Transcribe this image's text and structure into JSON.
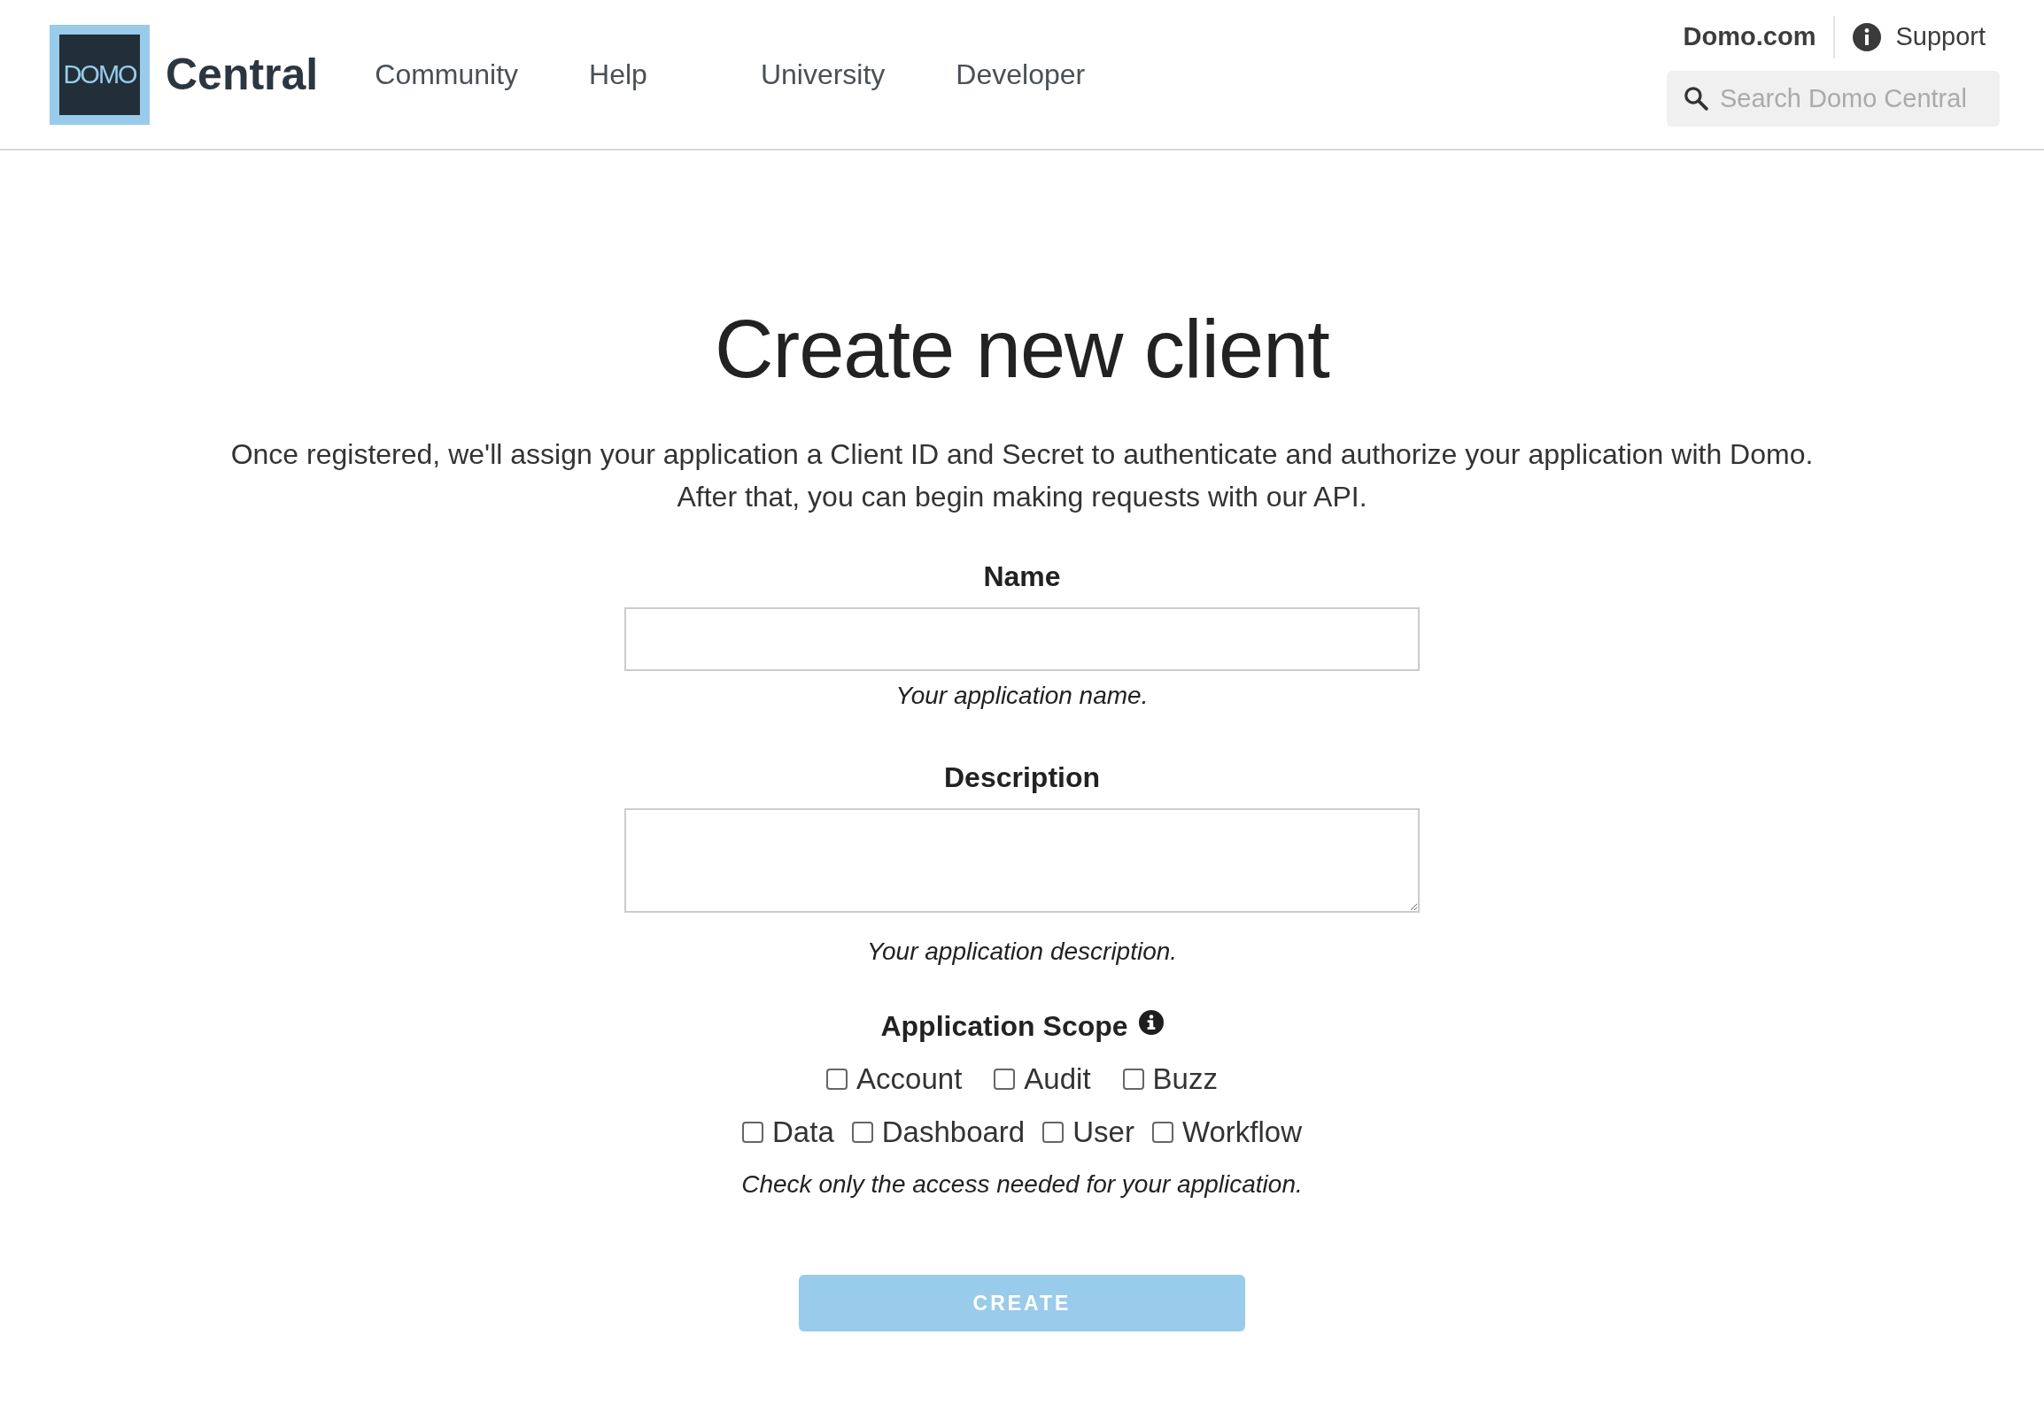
{
  "header": {
    "logo_text": "DOMO",
    "brand": "Central",
    "nav": [
      {
        "label": "Community"
      },
      {
        "label": "Help"
      },
      {
        "label": "University"
      },
      {
        "label": "Developer"
      }
    ],
    "site_link": "Domo.com",
    "support_link": "Support",
    "search": {
      "placeholder": "Search Domo Central"
    }
  },
  "form": {
    "title": "Create new client",
    "intro": [
      "Once registered, we'll assign your application a Client ID and Secret to authenticate and authorize your application with Domo.",
      "After that, you can begin making requests with our API."
    ],
    "fields": [
      {
        "kind": "input",
        "label": "Name",
        "hint": "Your application name."
      },
      {
        "kind": "textarea",
        "label": "Description",
        "hint": "Your application description."
      }
    ],
    "scope": {
      "label": "Application Scope",
      "lines": [
        {
          "options": [
            {
              "label": "Account",
              "checked": false
            },
            {
              "label": "Audit",
              "checked": false
            },
            {
              "label": "Buzz",
              "checked": false
            }
          ]
        },
        {
          "options": [
            {
              "label": "Data",
              "checked": false
            },
            {
              "label": "Dashboard",
              "checked": false
            },
            {
              "label": "User",
              "checked": false
            },
            {
              "label": "Workflow",
              "checked": false
            }
          ]
        }
      ],
      "hint": "Check only the access needed for your application."
    },
    "submit": {
      "label": "CREATE",
      "disabled": true
    }
  }
}
